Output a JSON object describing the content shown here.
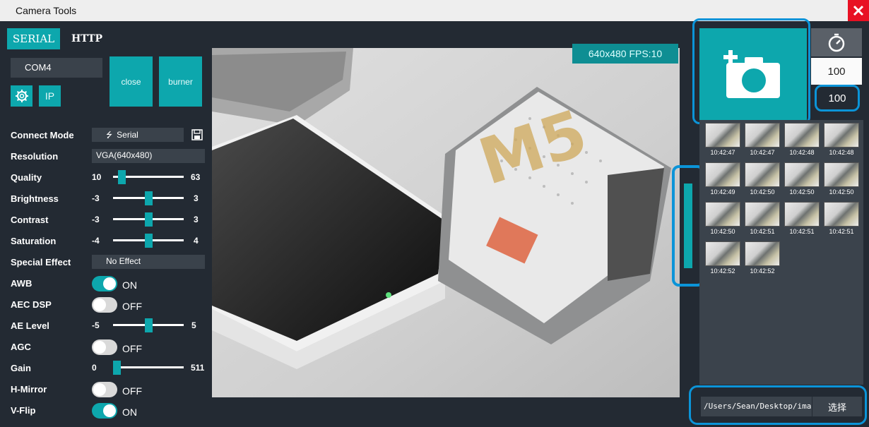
{
  "window": {
    "title": "Camera Tools"
  },
  "tabs": [
    {
      "label": "SERIAL",
      "active": true
    },
    {
      "label": "HTTP",
      "active": false
    }
  ],
  "connection": {
    "port": "COM4",
    "close_label": "close",
    "burner_label": "burner",
    "ip_label": "IP"
  },
  "settings": {
    "connect_mode": {
      "label": "Connect Mode",
      "value": "Serial"
    },
    "resolution": {
      "label": "Resolution",
      "value": "VGA(640x480)"
    },
    "quality": {
      "label": "Quality",
      "min": "10",
      "max": "63",
      "level": 0.08
    },
    "brightness": {
      "label": "Brightness",
      "min": "-3",
      "max": "3",
      "level": 0.5
    },
    "contrast": {
      "label": "Contrast",
      "min": "-3",
      "max": "3",
      "level": 0.5
    },
    "saturation": {
      "label": "Saturation",
      "min": "-4",
      "max": "4",
      "level": 0.5
    },
    "special_effect": {
      "label": "Special Effect",
      "value": "No Effect"
    },
    "awb": {
      "label": "AWB",
      "state": "ON"
    },
    "aec_dsp": {
      "label": "AEC DSP",
      "state": "OFF"
    },
    "ae_level": {
      "label": "AE Level",
      "min": "-5",
      "max": "5",
      "level": 0.5
    },
    "agc": {
      "label": "AGC",
      "state": "OFF"
    },
    "gain": {
      "label": "Gain",
      "min": "0",
      "max": "511",
      "level": 0.0
    },
    "h_mirror": {
      "label": "H-Mirror",
      "state": "OFF"
    },
    "v_flip": {
      "label": "V-Flip",
      "state": "ON"
    }
  },
  "preview": {
    "fps_label": "640x480 FPS:10",
    "logo_text": "M5"
  },
  "capture": {
    "interval": "100",
    "count": "100"
  },
  "gallery": [
    "10:42:47",
    "10:42:47",
    "10:42:48",
    "10:42:48",
    "10:42:49",
    "10:42:50",
    "10:42:50",
    "10:42:50",
    "10:42:50",
    "10:42:51",
    "10:42:51",
    "10:42:51",
    "10:42:52",
    "10:42:52"
  ],
  "save_path": {
    "value": "/Users/Sean/Desktop/image",
    "button_label": "选择"
  },
  "colors": {
    "accent": "#0da7ad",
    "highlight": "#0b94d8",
    "background": "#232a33",
    "close": "#e81123"
  },
  "icons": [
    "close-icon",
    "gear-icon",
    "usb-icon",
    "save-icon",
    "add-camera-icon",
    "timer-icon"
  ]
}
